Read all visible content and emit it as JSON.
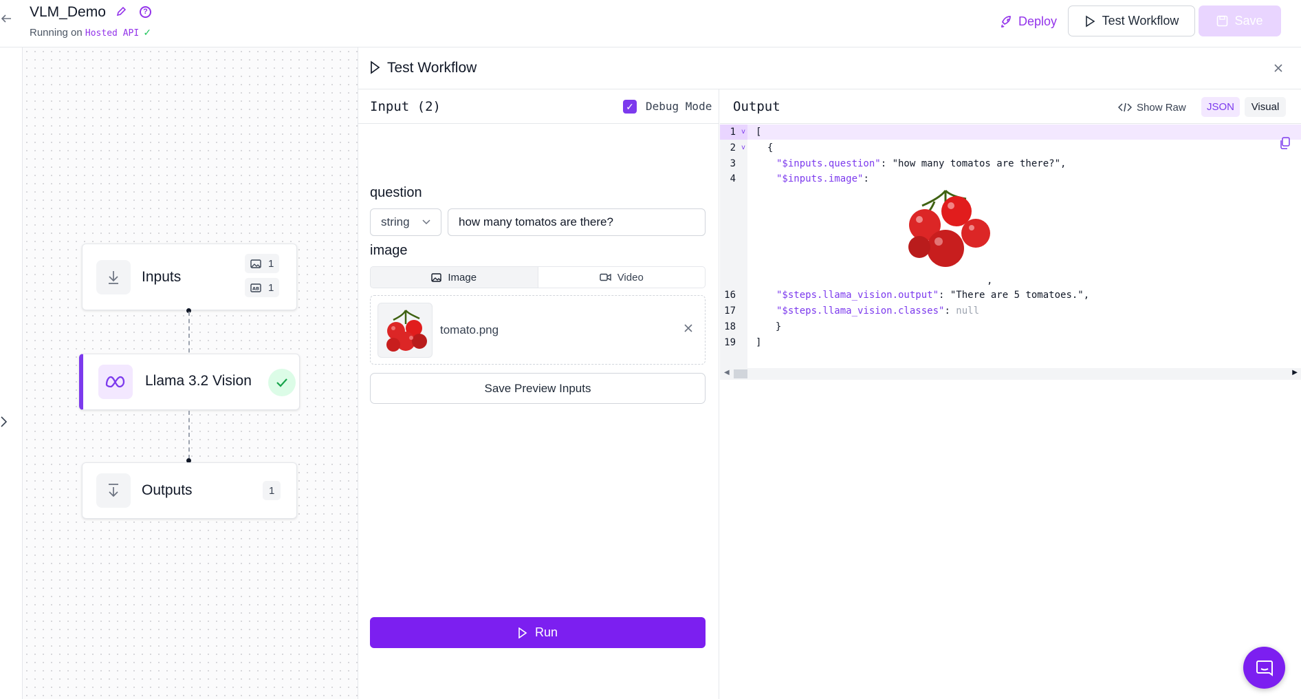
{
  "header": {
    "title": "VLM_Demo",
    "running_prefix": "Running on",
    "running_target": "Hosted API",
    "deploy_label": "Deploy",
    "test_workflow_label": "Test Workflow",
    "save_label": "Save"
  },
  "nodes": {
    "inputs": {
      "label": "Inputs",
      "image_count": "1",
      "text_count": "1"
    },
    "model": {
      "label": "Llama 3.2 Vision"
    },
    "outputs": {
      "label": "Outputs",
      "count": "1"
    }
  },
  "panel": {
    "title": "Test Workflow",
    "input": {
      "heading": "Input (2)",
      "debug_label": "Debug Mode",
      "debug_checked": true,
      "question_label": "question",
      "question_type": "string",
      "question_value": "how many tomatos are there?",
      "image_label": "image",
      "tab_image": "Image",
      "tab_video": "Video",
      "file_name": "tomato.png",
      "save_preview_label": "Save Preview Inputs",
      "run_label": "Run"
    },
    "output": {
      "heading": "Output",
      "show_raw_label": "Show Raw",
      "json_label": "JSON",
      "visual_label": "Visual",
      "line_numbers": [
        "1",
        "2",
        "3",
        "4",
        "16",
        "17",
        "18",
        "19"
      ],
      "lines": {
        "l1": "[",
        "l2": "  {",
        "l3_key": "\"$inputs.question\"",
        "l3_val": ": \"how many tomatos are there?\",",
        "l4_key": "\"$inputs.image\"",
        "l4_val": ":",
        "l16_key": "\"$steps.llama_vision.output\"",
        "l16_val": ": \"There are 5 tomatoes.\",",
        "l17_key": "\"$steps.llama_vision.classes\"",
        "l17_sep": ": ",
        "l17_val": "null",
        "l18": "  }",
        "l19": "]",
        "comma": ","
      }
    }
  },
  "colors": {
    "accent": "#7c3aed",
    "run_button": "#7c1ff0",
    "success": "#22c55e"
  }
}
